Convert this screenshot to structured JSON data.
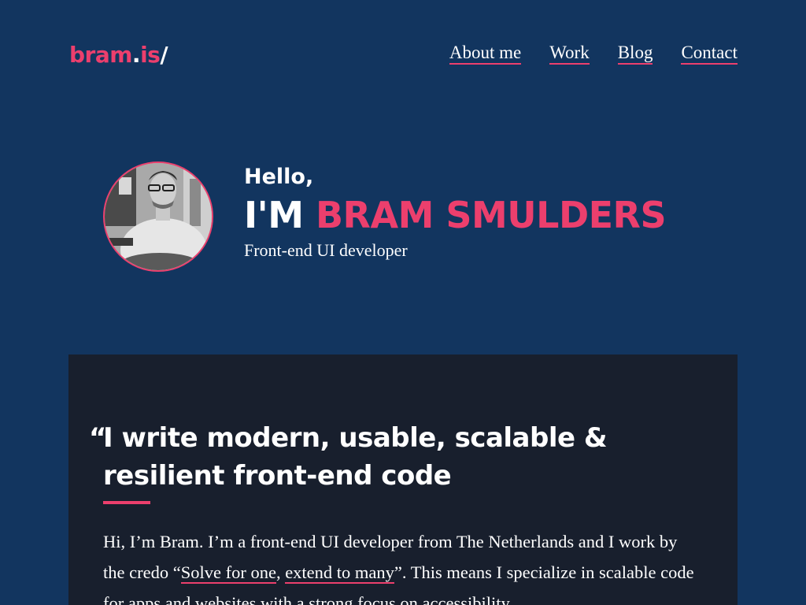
{
  "header": {
    "logo": {
      "part1": "bram",
      "dot": ".",
      "part2": "is",
      "slash": "/"
    },
    "nav": [
      "About me",
      "Work",
      "Blog",
      "Contact"
    ]
  },
  "hero": {
    "greeting": "Hello,",
    "name_prefix": "I'M ",
    "name": "BRAM SMULDERS",
    "role": "Front-end UI developer"
  },
  "about": {
    "quote_mark": "“",
    "quote": "I write modern, usable, scalable & resilient front-end code",
    "intro_part1": "Hi, I’m Bram. I’m a front-end UI developer from The Netherlands and I work by the credo “",
    "link1": "Solve for one",
    "comma": ", ",
    "link2": "extend to many",
    "intro_part2": "”. This means I specialize in scalable code for apps and websites with a strong focus on accessibility."
  },
  "colors": {
    "background": "#12355f",
    "card": "#181f2d",
    "accent": "#ec3f6d",
    "text": "#ffffff"
  }
}
